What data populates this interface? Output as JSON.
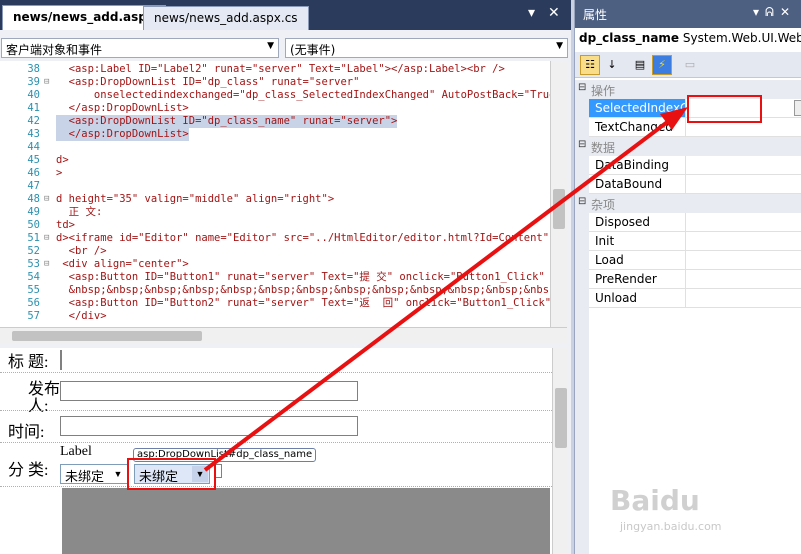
{
  "tabs": [
    {
      "label": "news/news_add.aspx",
      "active": true
    },
    {
      "label": "news/news_add.aspx.cs",
      "active": false
    }
  ],
  "navbar": {
    "left_select": "客户端对象和事件",
    "right_select": "(无事件)"
  },
  "code_lines": [
    {
      "num": "38",
      "text": "  <asp:Label ID=\"Label2\" runat=\"server\" Text=\"Label\"></asp:Label><br />",
      "fold": "",
      "selected": false
    },
    {
      "num": "39",
      "text": "  <asp:DropDownList ID=\"dp_class\" runat=\"server\"",
      "fold": "⊟",
      "selected": false
    },
    {
      "num": "40",
      "text": "      onselectedindexchanged=\"dp_class_SelectedIndexChanged\" AutoPostBack=\"True\">",
      "fold": "",
      "selected": false
    },
    {
      "num": "41",
      "text": "  </asp:DropDownList>",
      "fold": "",
      "selected": false
    },
    {
      "num": "42",
      "text": "  <asp:DropDownList ID=\"dp_class_name\" runat=\"server\">",
      "fold": "",
      "selected": true
    },
    {
      "num": "43",
      "text": "  </asp:DropDownList>",
      "fold": "",
      "selected": true
    },
    {
      "num": "44",
      "text": "",
      "fold": "",
      "selected": false
    },
    {
      "num": "45",
      "text": "d>",
      "fold": "",
      "selected": false
    },
    {
      "num": "46",
      "text": ">",
      "fold": "",
      "selected": false
    },
    {
      "num": "47",
      "text": "",
      "fold": "",
      "selected": false
    },
    {
      "num": "48",
      "text": "d height=\"35\" valign=\"middle\" align=\"right\">",
      "fold": "⊟",
      "selected": false
    },
    {
      "num": "49",
      "text": "  正 文:",
      "fold": "",
      "selected": false
    },
    {
      "num": "50",
      "text": "td>",
      "fold": "",
      "selected": false
    },
    {
      "num": "51",
      "text": "d><iframe id=\"Editor\" name=\"Editor\" src=\"../HtmlEditor/editor.html?Id=Content\" fra",
      "fold": "⊟",
      "selected": false
    },
    {
      "num": "52",
      "text": "  <br />",
      "fold": "",
      "selected": false
    },
    {
      "num": "53",
      "text": " <div align=\"center\">",
      "fold": "⊟",
      "selected": false
    },
    {
      "num": "54",
      "text": "  <asp:Button ID=\"Button1\" runat=\"server\" Text=\"提 交\" onclick=\"Button1_Click\" />",
      "fold": "",
      "selected": false
    },
    {
      "num": "55",
      "text": "  &nbsp;&nbsp;&nbsp;&nbsp;&nbsp;&nbsp;&nbsp;&nbsp;&nbsp;&nbsp;&nbsp;&nbsp;&nbsp;&nbsp;&nb",
      "fold": "",
      "selected": false
    },
    {
      "num": "56",
      "text": "  <asp:Button ID=\"Button2\" runat=\"server\" Text=\"返  回\" onclick=\"Button1_Click\" />",
      "fold": "",
      "selected": false
    },
    {
      "num": "57",
      "text": "  </div>",
      "fold": "",
      "selected": false
    }
  ],
  "design": {
    "label_title": "标 题:",
    "label_publisher_1": "发布",
    "label_publisher_2": "人:",
    "label_time": "时间:",
    "label_category": "分 类:",
    "asp_label": "Label",
    "ddl1_value": "未绑定",
    "ddl2_value": "未绑定",
    "tooltip": "asp:DropDownList#dp_class_name"
  },
  "properties": {
    "title": "属性",
    "object_name": "dp_class_name",
    "object_type": "System.Web.UI.Web(",
    "categories": [
      {
        "name": "操作",
        "items": [
          {
            "name": "SelectedIndexC",
            "selected": true
          },
          {
            "name": "TextChanged",
            "selected": false
          }
        ]
      },
      {
        "name": "数据",
        "items": [
          {
            "name": "DataBinding",
            "selected": false
          },
          {
            "name": "DataBound",
            "selected": false
          }
        ]
      },
      {
        "name": "杂项",
        "items": [
          {
            "name": "Disposed",
            "selected": false
          },
          {
            "name": "Init",
            "selected": false
          },
          {
            "name": "Load",
            "selected": false
          },
          {
            "name": "PreRender",
            "selected": false
          },
          {
            "name": "Unload",
            "selected": false
          }
        ]
      }
    ]
  },
  "watermark": {
    "brand": "Baidu经验",
    "url": "jingyan.baidu.com"
  },
  "colors": {
    "highlight_box": "#e81010",
    "selection": "#3399ff",
    "title_bar": "#4d6082"
  }
}
